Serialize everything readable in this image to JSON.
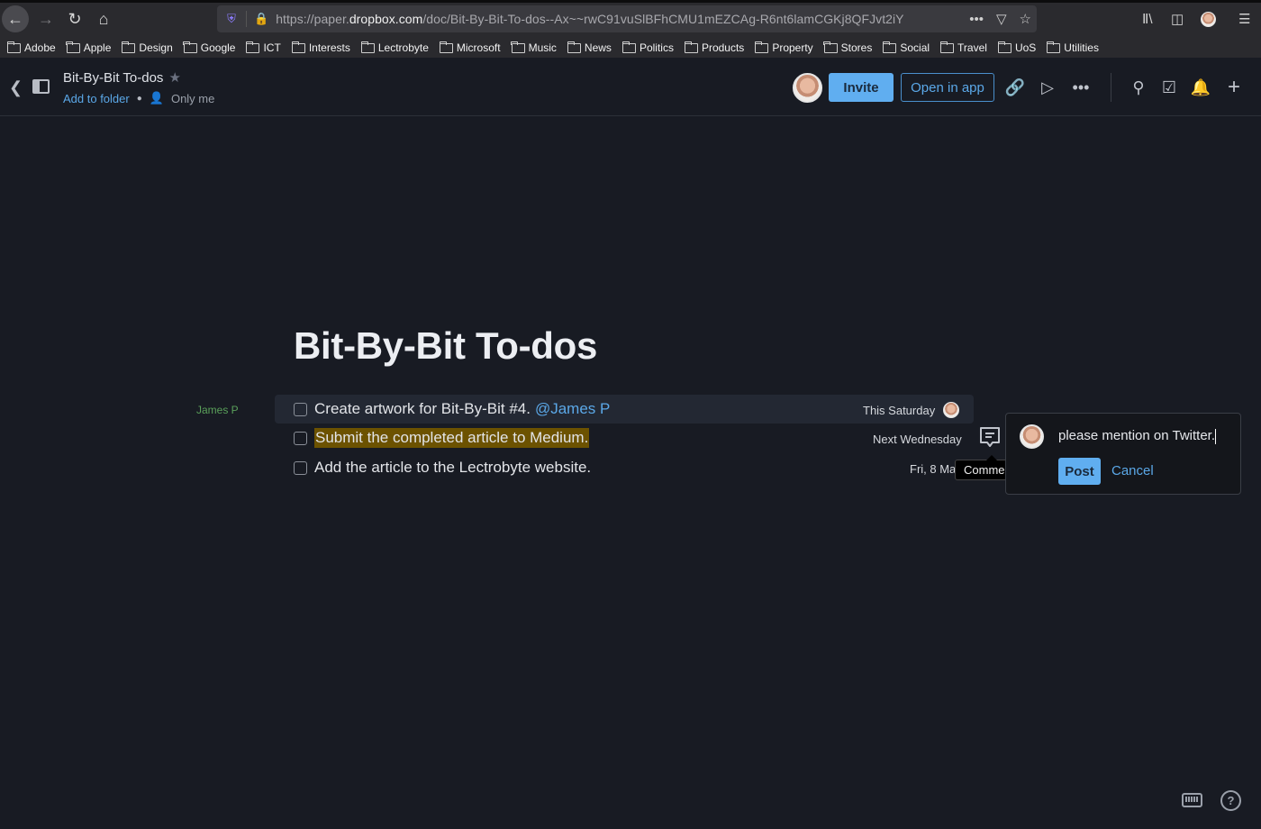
{
  "browser": {
    "url_prefix": "https://paper.",
    "url_domain": "dropbox.com",
    "url_path": "/doc/Bit-By-Bit-To-dos--Ax~~rwC91vuSlBFhCMU1mEZCAg-R6nt6lamCGKj8QFJvt2iY",
    "bookmarks": [
      "Adobe",
      "Apple",
      "Design",
      "Google",
      "ICT",
      "Interests",
      "Lectrobyte",
      "Microsoft",
      "Music",
      "News",
      "Politics",
      "Products",
      "Property",
      "Stores",
      "Social",
      "Travel",
      "UoS",
      "Utilities"
    ]
  },
  "header": {
    "doc_title": "Bit-By-Bit To-dos",
    "add_to_folder": "Add to folder",
    "sharing": "Only me",
    "invite_label": "Invite",
    "open_in_app_label": "Open in app"
  },
  "document": {
    "title": "Bit-By-Bit To-dos",
    "author_label": "James P",
    "todos": [
      {
        "text": "Create artwork for Bit-By-Bit #4.",
        "mention": "@James P",
        "due": "This Saturday",
        "checked": false,
        "highlighted": false
      },
      {
        "text": "Submit the completed article to Medium.",
        "mention": "",
        "due": "Next Wednesday",
        "checked": false,
        "highlighted": true
      },
      {
        "text": "Add the article to the Lectrobyte website.",
        "mention": "",
        "due": "Fri, 8 Ma",
        "checked": false,
        "highlighted": false
      }
    ]
  },
  "comment": {
    "tooltip": "Comment",
    "input_value": "please mention on Twitter.",
    "post_label": "Post",
    "cancel_label": "Cancel"
  },
  "footer": {
    "help_glyph": "?"
  }
}
